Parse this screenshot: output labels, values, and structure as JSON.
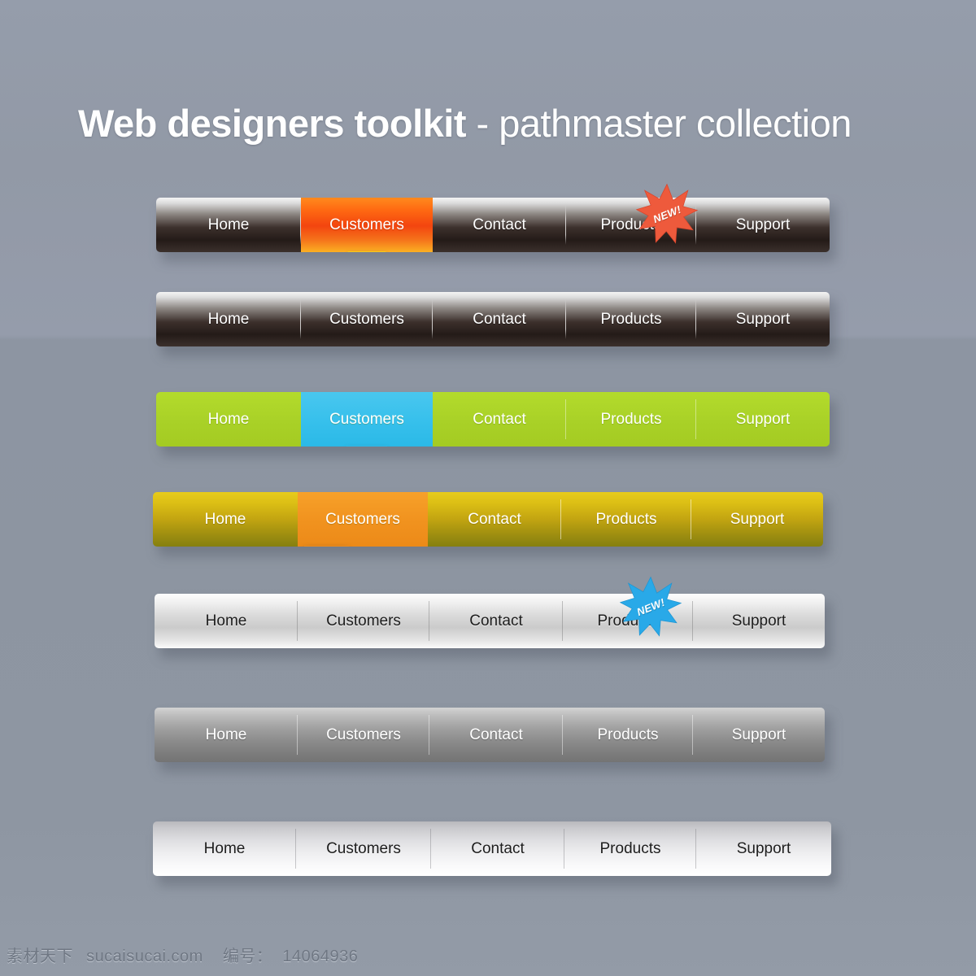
{
  "title": {
    "bold_part": "Web designers toolkit",
    "light_part": " - pathmaster collection"
  },
  "badge": {
    "label": "NEW!"
  },
  "colors": {
    "background_top": "#959dab",
    "background_bottom": "#8d95a1",
    "dark_bar_top": "#f4f4f4",
    "dark_bar_bottom": "#241b18",
    "orange_active": "#f3450f",
    "yellow_arrow": "#f9c81b",
    "green_bar": "#a9d127",
    "cyan_active": "#35bfeb",
    "gold_bar_top": "#e7cb1b",
    "gold_bar_bottom": "#85800f",
    "gold_active": "#f1931f",
    "silver_bar": "#dadada",
    "gray_bar": "#8b8b8b",
    "badge_red": "#ee5a3c",
    "badge_blue": "#29a9e8",
    "text_light": "#ffffff",
    "text_dark": "#1d1d1d"
  },
  "menus": [
    {
      "id": "menu-dark-active",
      "style": "dark",
      "items": [
        {
          "label": "Home",
          "state": "normal"
        },
        {
          "label": "Customers",
          "state": "active"
        },
        {
          "label": "Contact",
          "state": "normal"
        },
        {
          "label": "Products",
          "state": "normal",
          "badge": "NEW!",
          "badge_color": "red"
        },
        {
          "label": "Support",
          "state": "normal"
        }
      ]
    },
    {
      "id": "menu-dark-plain",
      "style": "dark",
      "items": [
        {
          "label": "Home",
          "state": "normal"
        },
        {
          "label": "Customers",
          "state": "normal"
        },
        {
          "label": "Contact",
          "state": "normal"
        },
        {
          "label": "Products",
          "state": "normal"
        },
        {
          "label": "Support",
          "state": "normal"
        }
      ]
    },
    {
      "id": "menu-green",
      "style": "green",
      "items": [
        {
          "label": "Home",
          "state": "normal"
        },
        {
          "label": "Customers",
          "state": "active"
        },
        {
          "label": "Contact",
          "state": "normal"
        },
        {
          "label": "Products",
          "state": "normal"
        },
        {
          "label": "Support",
          "state": "normal"
        }
      ]
    },
    {
      "id": "menu-gold",
      "style": "gold",
      "items": [
        {
          "label": "Home",
          "state": "normal"
        },
        {
          "label": "Customers",
          "state": "active"
        },
        {
          "label": "Contact",
          "state": "normal"
        },
        {
          "label": "Products",
          "state": "normal"
        },
        {
          "label": "Support",
          "state": "normal"
        }
      ]
    },
    {
      "id": "menu-silver",
      "style": "silver",
      "items": [
        {
          "label": "Home",
          "state": "normal"
        },
        {
          "label": "Customers",
          "state": "normal"
        },
        {
          "label": "Contact",
          "state": "normal"
        },
        {
          "label": "Products",
          "state": "normal",
          "badge": "NEW!",
          "badge_color": "blue"
        },
        {
          "label": "Support",
          "state": "normal"
        }
      ]
    },
    {
      "id": "menu-gray",
      "style": "gray",
      "items": [
        {
          "label": "Home",
          "state": "normal"
        },
        {
          "label": "Customers",
          "state": "normal"
        },
        {
          "label": "Contact",
          "state": "normal"
        },
        {
          "label": "Products",
          "state": "normal"
        },
        {
          "label": "Support",
          "state": "normal"
        }
      ]
    },
    {
      "id": "menu-light",
      "style": "light",
      "items": [
        {
          "label": "Home",
          "state": "normal"
        },
        {
          "label": "Customers",
          "state": "normal"
        },
        {
          "label": "Contact",
          "state": "normal"
        },
        {
          "label": "Products",
          "state": "normal"
        },
        {
          "label": "Support",
          "state": "normal"
        }
      ]
    }
  ],
  "footer": {
    "site_name": "素材天下",
    "domain": "sucaisucai.com",
    "id_label": "编号：",
    "id_value": "14064936"
  }
}
